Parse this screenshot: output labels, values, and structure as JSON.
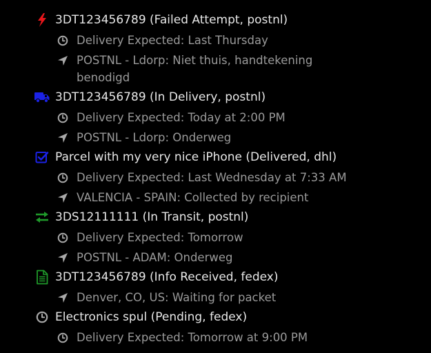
{
  "colors": {
    "failed": "#e8161b",
    "in_delivery": "#1b22e6",
    "delivered": "#1b22e6",
    "in_transit": "#1f9a2a",
    "info_received": "#1f9a2a",
    "pending": "#a8a8a8",
    "title_text": "#e8e8e8",
    "detail_text": "#9a9a9a",
    "detail_icon": "#a8a8a8"
  },
  "parcels": [
    {
      "title": "3DT123456789 (Failed Attempt, postnl)",
      "status_icon": "bolt-icon",
      "expected": "Delivery Expected: Last Thursday",
      "location": "POSTNL - Ldorp: Niet thuis, handtekening benodigd"
    },
    {
      "title": "3DT123456789 (In Delivery, postnl)",
      "status_icon": "truck-icon",
      "expected": "Delivery Expected: Today at 2:00 PM",
      "location": "POSTNL - Ldorp: Onderweg"
    },
    {
      "title": "Parcel with my very nice iPhone (Delivered, dhl)",
      "status_icon": "checkbox-icon",
      "expected": "Delivery Expected: Last Wednesday at 7:33 AM",
      "location": "VALENCIA - SPAIN: Collected by recipient"
    },
    {
      "title": "3DS12111111 (In Transit, postnl)",
      "status_icon": "exchange-icon",
      "expected": "Delivery Expected: Tomorrow",
      "location": "POSTNL - ADAM: Onderweg"
    },
    {
      "title": "3DT123456789 (Info Received, fedex)",
      "status_icon": "document-icon",
      "location": "Denver, CO, US: Waiting for packet"
    },
    {
      "title": "Electronics spul (Pending, fedex)",
      "status_icon": "clock-icon",
      "expected": "Delivery Expected: Tomorrow at 9:00 PM"
    }
  ]
}
